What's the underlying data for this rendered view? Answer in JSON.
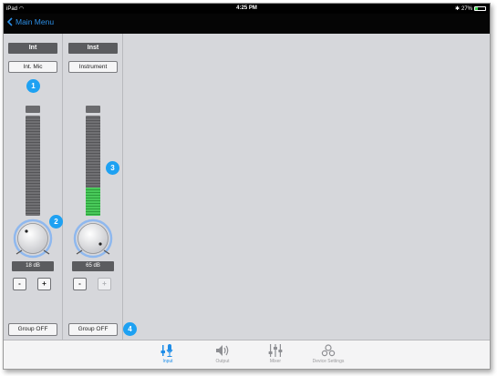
{
  "status_bar": {
    "device": "iPad",
    "time": "4:25 PM",
    "battery": "27%",
    "battery_level": 0.27
  },
  "nav": {
    "back_label": "Main Menu"
  },
  "channels": [
    {
      "label": "Int",
      "source": "Int. Mic",
      "gain": "18 dB",
      "meter_level": 0.0,
      "minus": "-",
      "plus": "+",
      "plus_enabled": true,
      "group": "Group OFF"
    },
    {
      "label": "Inst",
      "source": "Instrument",
      "gain": "65 dB",
      "meter_level": 0.28,
      "minus": "-",
      "plus": "+",
      "plus_enabled": false,
      "group": "Group OFF"
    }
  ],
  "callouts": [
    "1",
    "2",
    "3",
    "4"
  ],
  "tabs": [
    {
      "label": "Input",
      "icon": "microphone-mixer-icon",
      "active": true
    },
    {
      "label": "Output",
      "icon": "speaker-icon",
      "active": false
    },
    {
      "label": "Mixer",
      "icon": "faders-icon",
      "active": false
    },
    {
      "label": "Device Settings",
      "icon": "gears-icon",
      "active": false
    }
  ],
  "colors": {
    "accent": "#1e8de8",
    "callout": "#1ea1f2",
    "meter_green": "#49c95a"
  }
}
